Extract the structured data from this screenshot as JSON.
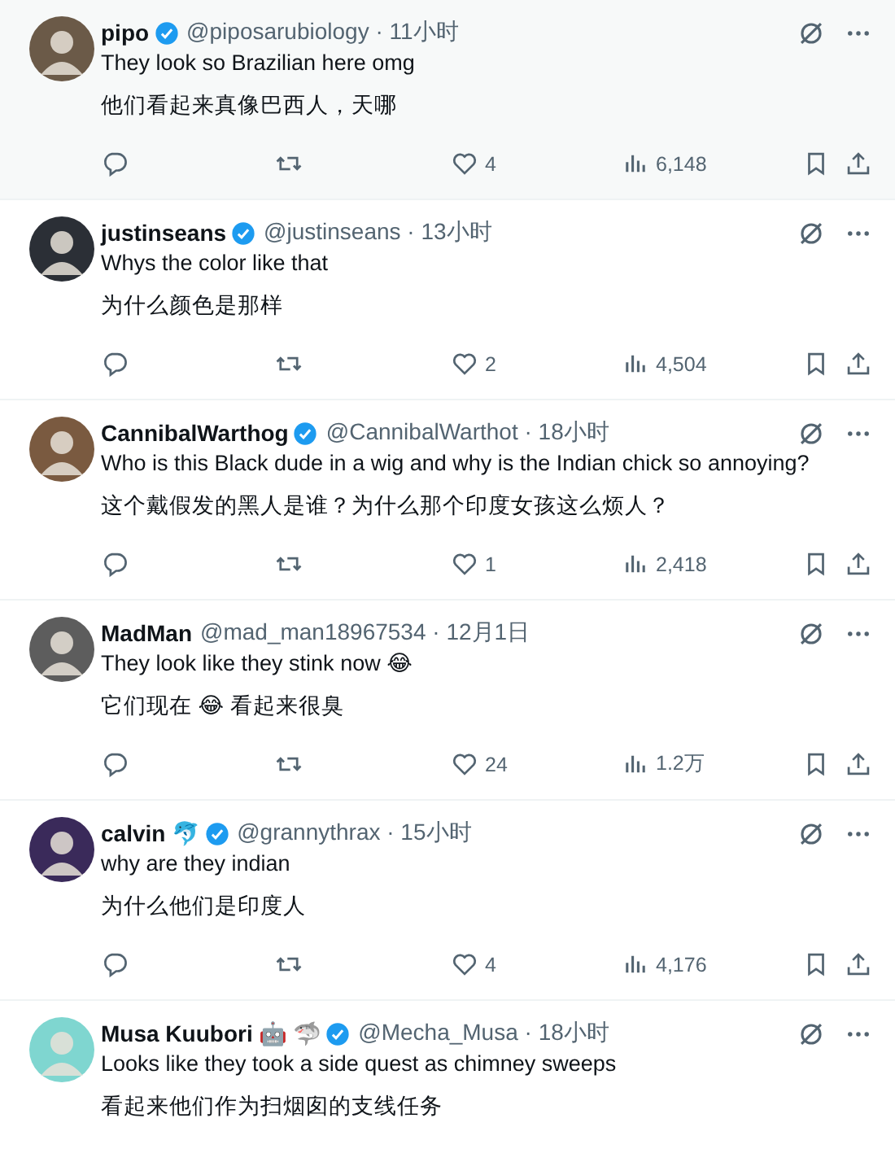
{
  "posts": [
    {
      "name": "pipo",
      "verified": true,
      "meta": "@piposarubiology · 11小时",
      "hovered": true,
      "lines": [
        "They look so Brazilian here omg",
        "他们看起来真像巴西人，天哪"
      ],
      "stats": {
        "likes": "4",
        "views": "6,148"
      }
    },
    {
      "name": "justinseans",
      "verified": true,
      "meta": "@justinseans · 13小时",
      "hovered": false,
      "lines": [
        "Whys the color like that",
        "为什么颜色是那样"
      ],
      "stats": {
        "likes": "2",
        "views": "4,504"
      }
    },
    {
      "name": "CannibalWarthog",
      "verified": true,
      "meta": "@CannibalWarthot · 18小时",
      "hovered": false,
      "lines": [
        "Who is this Black dude in a wig and why is the Indian chick so annoying?",
        "这个戴假发的黑人是谁？为什么那个印度女孩这么烦人？"
      ],
      "stats": {
        "likes": "1",
        "views": "2,418"
      }
    },
    {
      "name": "MadMan",
      "verified": false,
      "meta": "@mad_man18967534 · 12月1日",
      "hovered": false,
      "lines": [
        "They look like they stink now 😂",
        "它们现在 😂 看起来很臭"
      ],
      "stats": {
        "likes": "24",
        "views": "1.2万"
      }
    },
    {
      "name": "calvin 🐬",
      "verified": true,
      "meta": "@grannythrax · 15小时",
      "hovered": false,
      "lines": [
        "why are they indian",
        "为什么他们是印度人"
      ],
      "stats": {
        "likes": "4",
        "views": "4,176"
      }
    },
    {
      "name": "Musa Kuubori 🤖 🦈",
      "verified": true,
      "meta": "@Mecha_Musa · 18小时",
      "hovered": false,
      "lines": [
        "Looks like they took a side quest as chimney sweeps",
        "看起来他们作为扫烟囱的支线任务"
      ]
    }
  ]
}
